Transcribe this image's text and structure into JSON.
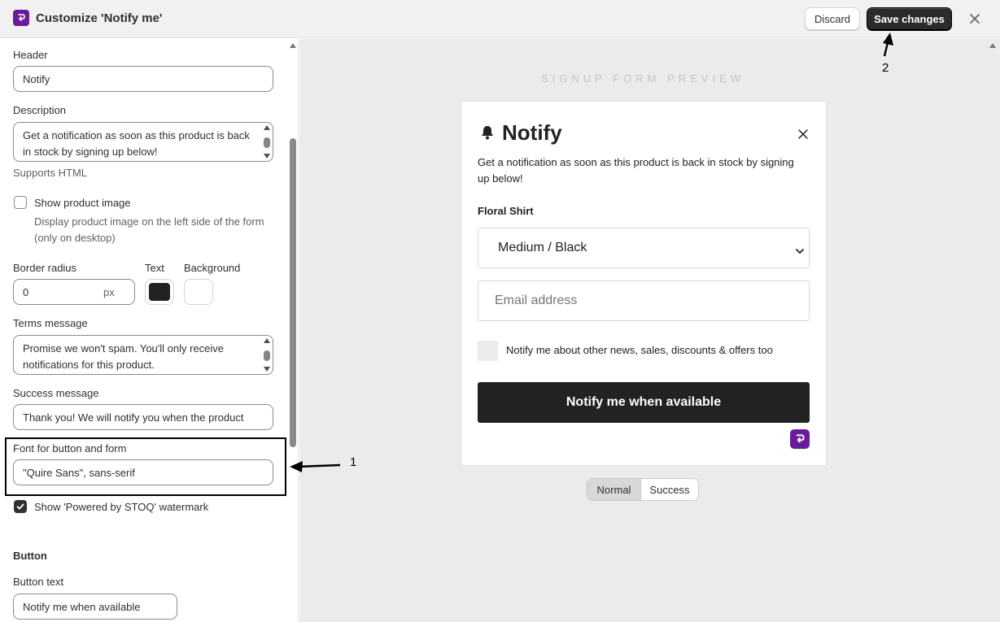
{
  "header": {
    "title": "Customize 'Notify me'",
    "discard_label": "Discard",
    "save_label": "Save changes"
  },
  "settings": {
    "header_label": "Header",
    "header_value": "Notify",
    "description_label": "Description",
    "description_value": "Get a notification as soon as this product is back in stock by signing up below!",
    "description_help": "Supports HTML",
    "show_image_label": "Show product image",
    "show_image_help": "Display product image on the left side of the form (only on desktop)",
    "border_radius_label": "Border radius",
    "border_radius_value": "0",
    "border_radius_unit": "px",
    "text_color_label": "Text",
    "text_color": "#222222",
    "background_color_label": "Background",
    "background_color": "#ffffff",
    "terms_label": "Terms message",
    "terms_value": "Promise we won't spam. You'll only receive notifications for this product.",
    "success_label": "Success message",
    "success_value": "Thank you! We will notify you when the product",
    "font_label": "Font for button and form",
    "font_value": "\"Quire Sans\", sans-serif",
    "watermark_label": "Show 'Powered by STOQ' watermark",
    "watermark_checked": true,
    "button_section": "Button",
    "button_text_label": "Button text",
    "button_text_value": "Notify me when available"
  },
  "preview": {
    "label": "SIGNUP FORM PREVIEW",
    "title": "Notify",
    "description": "Get a notification as soon as this product is back in stock by signing up below!",
    "product_name": "Floral Shirt",
    "variant": "Medium / Black",
    "email_placeholder": "Email address",
    "newsletter_label": "Notify me about other news, sales, discounts & offers too",
    "button_label": "Notify me when available",
    "toggle_normal": "Normal",
    "toggle_success": "Success"
  },
  "annotations": {
    "one": "1",
    "two": "2"
  },
  "colors": {
    "brand": "#6a1b9a",
    "primary_button": "#2b2b2b"
  },
  "icons": {
    "app_logo": "stoq-logo-icon",
    "close": "close-icon",
    "bell": "bell-icon",
    "chevron": "chevron-down-icon",
    "check": "checkmark-icon"
  }
}
